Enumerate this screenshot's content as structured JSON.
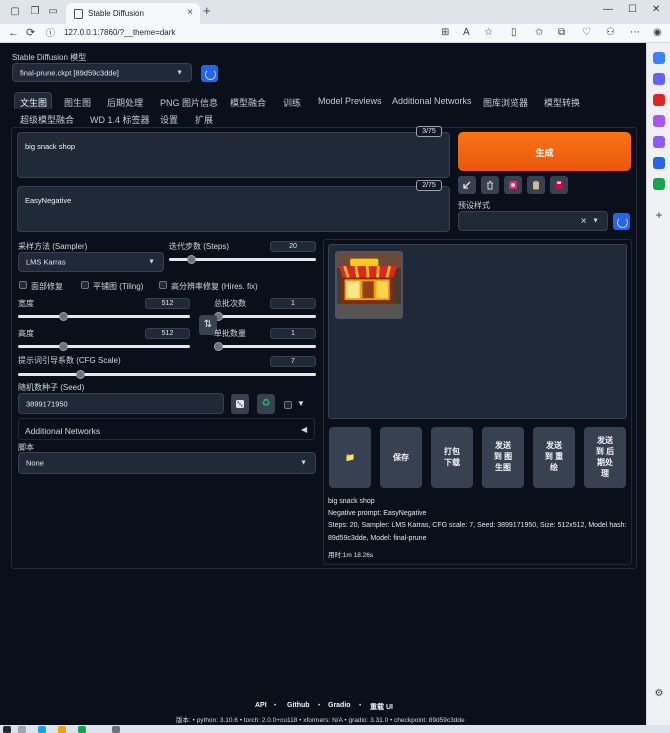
{
  "browser": {
    "tab_title": "Stable Diffusion",
    "url": "127.0.0.1:7860/?__theme=dark"
  },
  "model": {
    "label": "Stable Diffusion 模型",
    "selected": "final-prune.ckpt [89d59c3dde]"
  },
  "tabs": [
    {
      "label": "文生图"
    },
    {
      "label": "图生图"
    },
    {
      "label": "后期处理"
    },
    {
      "label": "PNG 图片信息"
    },
    {
      "label": "模型融合"
    },
    {
      "label": "训练"
    },
    {
      "label": "Model Previews"
    },
    {
      "label": "Additional Networks"
    },
    {
      "label": "图库浏览器"
    },
    {
      "label": "模型转换"
    },
    {
      "label": "超级模型融合"
    },
    {
      "label": "WD 1.4 标签器"
    },
    {
      "label": "设置"
    },
    {
      "label": "扩展"
    }
  ],
  "prompt": {
    "value": "big snack shop",
    "counter": "3/75"
  },
  "negative_prompt": {
    "value": "EasyNegative",
    "counter": "2/75"
  },
  "generate_label": "生成",
  "preset_styles": {
    "label": "预设样式"
  },
  "sampler": {
    "label": "采样方法 (Sampler)",
    "value": "LMS Karras"
  },
  "steps": {
    "label": "迭代步数 (Steps)",
    "value": "20",
    "fraction": 0.13
  },
  "options": {
    "face_restore": "面部修复",
    "tiling": "平铺图 (Tiling)",
    "hires_fix": "高分辨率修复 (Hires. fix)"
  },
  "width": {
    "label": "宽度",
    "value": "512",
    "fraction": 0.25
  },
  "height": {
    "label": "高度",
    "value": "512",
    "fraction": 0.25
  },
  "batch_count": {
    "label": "总批次数",
    "value": "1",
    "fraction": 0.0
  },
  "batch_size": {
    "label": "单批数量",
    "value": "1",
    "fraction": 0.0
  },
  "cfg": {
    "label": "提示词引导系数 (CFG Scale)",
    "value": "7",
    "fraction": 0.2
  },
  "seed": {
    "label": "随机数种子 (Seed)",
    "value": "3899171950"
  },
  "additional_networks": {
    "label": "Additional Networks",
    "arrow": "◀"
  },
  "script": {
    "label": "脚本",
    "value": "None"
  },
  "actions": [
    {
      "label": "📁"
    },
    {
      "label": "保存"
    },
    {
      "label": "打包\n下载"
    },
    {
      "label": "发送\n到 图\n生图"
    },
    {
      "label": "发送\n到 重\n绘"
    },
    {
      "label": "发送\n到 后\n期处\n理"
    }
  ],
  "output_info": {
    "prompt": "big snack shop",
    "negative": "Negative prompt: EasyNegative",
    "params_1": "Steps: 20, Sampler: LMS Karras, CFG scale: 7, Seed: 3899171950, Size: 512x512, Model hash:",
    "params_2": "89d59c3dde, Model: final-prune",
    "time": "用时:1m 18.26s"
  },
  "footer": {
    "links": [
      "API",
      "Github",
      "Gradio",
      "重载 UI"
    ],
    "info": "版本: • python: 3.10.6 • torch: 2.0.0+cu118 • xformers: N/A • gradio: 3.31.0 • checkpoint: 89d59c3dde"
  },
  "colors": {
    "background": "#0b0f19",
    "surface": "#1f2937",
    "generate": "#f97316",
    "accent_blue": "#2563eb"
  }
}
